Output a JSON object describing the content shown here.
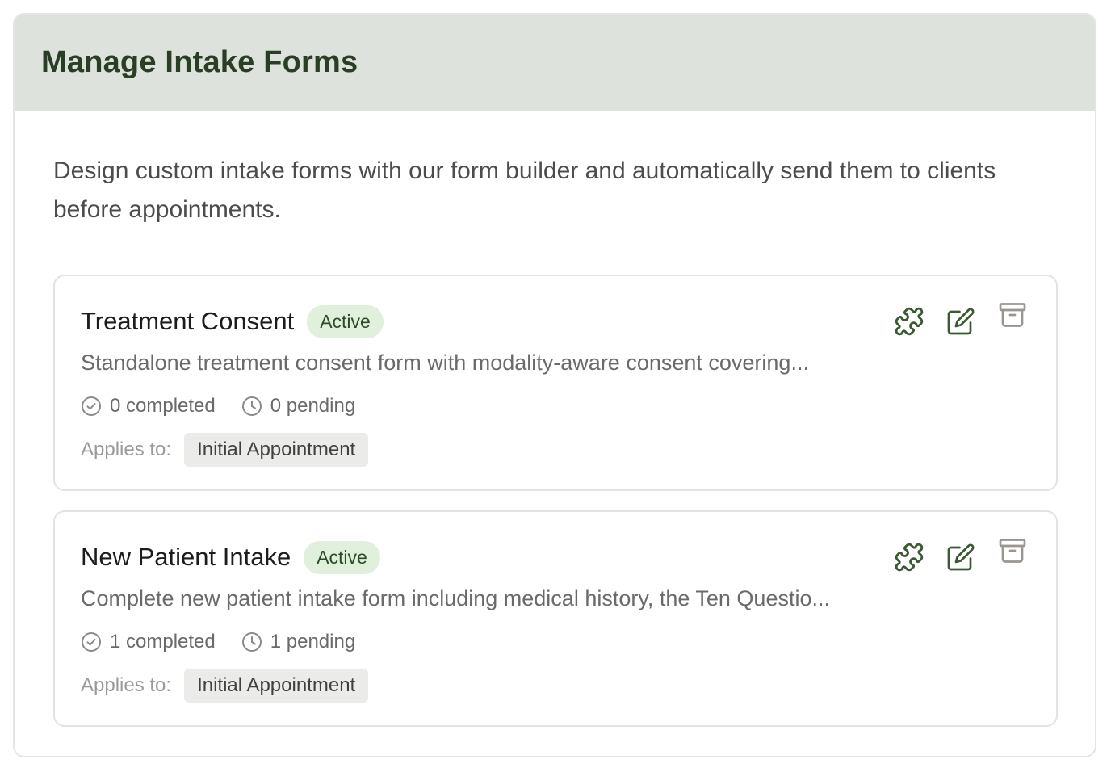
{
  "header": {
    "title": "Manage Intake Forms"
  },
  "intro": "Design custom intake forms with our form builder and automatically send them to clients before appointments.",
  "forms": [
    {
      "name": "Treatment Consent",
      "status": "Active",
      "description": "Standalone treatment consent form with modality-aware consent covering...",
      "completed": "0 completed",
      "pending": "0 pending",
      "applies_label": "Applies to:",
      "applies_to": "Initial Appointment"
    },
    {
      "name": "New Patient Intake",
      "status": "Active",
      "description": "Complete new patient intake form including medical history, the Ten Questio...",
      "completed": "1 completed",
      "pending": "1 pending",
      "applies_label": "Applies to:",
      "applies_to": "Initial Appointment"
    }
  ],
  "icons": {
    "builder": "puzzle-icon",
    "edit": "edit-icon",
    "archive": "archive-icon",
    "completed": "check-circle-icon",
    "pending": "clock-icon"
  },
  "colors": {
    "accent": "#3a5a32",
    "header_bg": "#dde2dc",
    "badge_bg": "#e1f0dc",
    "archive_icon": "#9a9590"
  }
}
